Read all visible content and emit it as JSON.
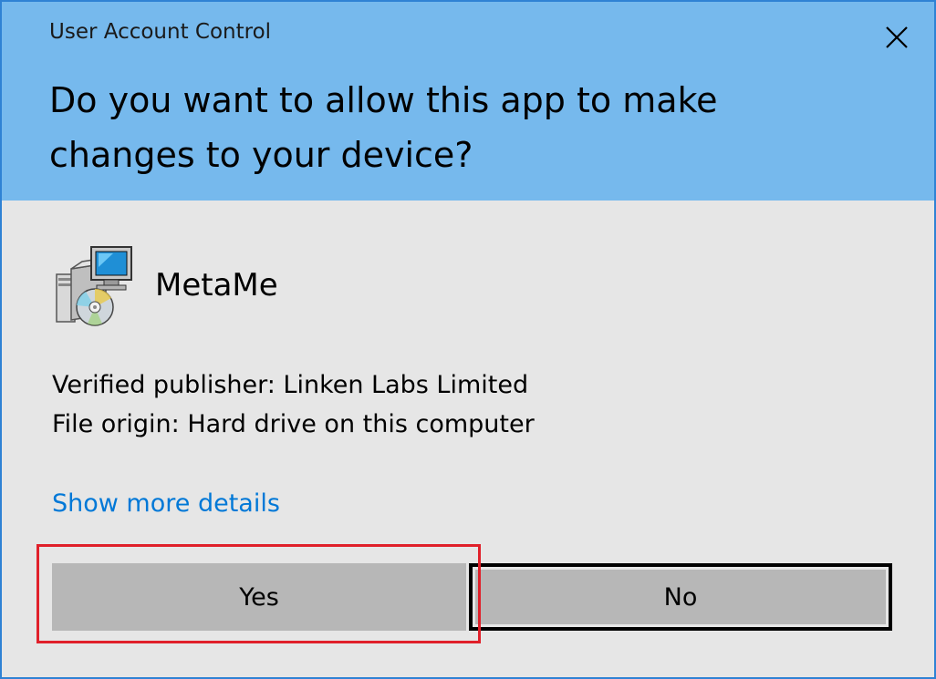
{
  "window": {
    "title": "User Account Control",
    "close_icon": "close-icon"
  },
  "prompt": {
    "question": "Do you want to allow this app to make changes to your device?"
  },
  "app": {
    "icon": "installer-icon",
    "name": "MetaMe"
  },
  "details": {
    "publisher": "Verified publisher: Linken Labs Limited",
    "origin": "File origin: Hard drive on this computer",
    "more_link": "Show more details"
  },
  "buttons": {
    "yes_label": "Yes",
    "no_label": "No"
  },
  "colors": {
    "header_bg": "#76b9ed",
    "body_bg": "#e6e6e6",
    "link": "#0078d7",
    "button_bg": "#b7b7b7",
    "highlight": "#e0202a",
    "window_border": "#2f82d4"
  }
}
